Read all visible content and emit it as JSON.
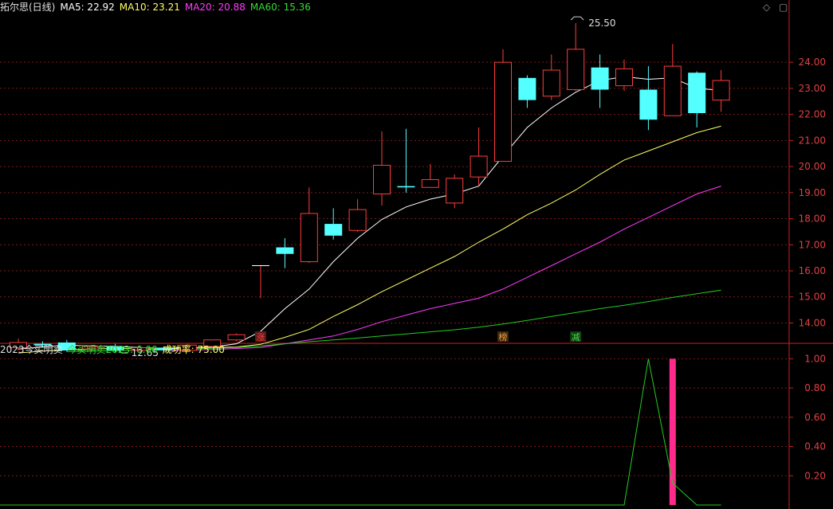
{
  "main_header": {
    "title": "拓尔思(日线)",
    "ma5": "MA5: 22.92",
    "ma10": "MA10: 23.21",
    "ma20": "MA20: 20.88",
    "ma60": "MA60: 15.36"
  },
  "sub_header": {
    "title": "2023今买明卖",
    "indicator": "今买明卖2023: 0.00",
    "success": "成功率: 75.00"
  },
  "corner_icons": [
    "diamond-icon",
    "restore-icon"
  ],
  "colors": {
    "up": "#ff3c3c",
    "down": "#54ffff",
    "ma5": "#ffffff",
    "ma10": "#ffff66",
    "ma20": "#ff3cff",
    "ma60": "#22cc22",
    "axis": "#cc2020",
    "signal_bar": "#ff2a8c"
  },
  "chart_data": [
    {
      "type": "candlestick",
      "title": "拓尔思(日线)",
      "ylim": [
        13.25,
        25.9
      ],
      "yticks": [
        14.0,
        15.0,
        16.0,
        17.0,
        18.0,
        19.0,
        20.0,
        21.0,
        22.0,
        23.0,
        24.0
      ],
      "ytick_labels": [
        "14.00",
        "15.00",
        "16.00",
        "17.00",
        "18.00",
        "19.00",
        "20.00",
        "21.00",
        "22.00",
        "23.00",
        "24.00"
      ],
      "candles": [
        {
          "o": 13.05,
          "h": 13.4,
          "l": 12.95,
          "c": 13.25
        },
        {
          "o": 13.2,
          "h": 13.3,
          "l": 13.05,
          "c": 13.15
        },
        {
          "o": 13.25,
          "h": 13.35,
          "l": 12.9,
          "c": 12.95
        },
        {
          "o": 13.0,
          "h": 13.15,
          "l": 12.9,
          "c": 13.1
        },
        {
          "o": 13.1,
          "h": 13.2,
          "l": 12.85,
          "c": 12.95
        },
        {
          "o": 12.95,
          "h": 13.15,
          "l": 12.9,
          "c": 13.05
        },
        {
          "o": 13.05,
          "h": 13.1,
          "l": 12.9,
          "c": 12.95
        },
        {
          "o": 12.95,
          "h": 13.2,
          "l": 12.9,
          "c": 13.15
        },
        {
          "o": 13.1,
          "h": 13.35,
          "l": 13.05,
          "c": 13.35
        },
        {
          "o": 13.35,
          "h": 13.6,
          "l": 13.3,
          "c": 13.55
        },
        {
          "o": 16.2,
          "h": 16.2,
          "l": 14.95,
          "c": 16.2
        },
        {
          "o": 16.9,
          "h": 17.25,
          "l": 16.1,
          "c": 16.65
        },
        {
          "o": 16.35,
          "h": 19.2,
          "l": 16.3,
          "c": 18.2
        },
        {
          "o": 17.8,
          "h": 18.4,
          "l": 17.2,
          "c": 17.35
        },
        {
          "o": 17.55,
          "h": 18.75,
          "l": 17.5,
          "c": 18.35
        },
        {
          "o": 18.95,
          "h": 21.35,
          "l": 18.5,
          "c": 20.05
        },
        {
          "o": 19.25,
          "h": 21.45,
          "l": 19.0,
          "c": 19.2
        },
        {
          "o": 19.2,
          "h": 20.1,
          "l": 19.2,
          "c": 19.5
        },
        {
          "o": 18.6,
          "h": 19.7,
          "l": 18.4,
          "c": 19.55
        },
        {
          "o": 19.6,
          "h": 21.5,
          "l": 19.3,
          "c": 20.4
        },
        {
          "o": 20.2,
          "h": 24.5,
          "l": 20.2,
          "c": 24.0
        },
        {
          "o": 23.4,
          "h": 23.5,
          "l": 22.25,
          "c": 22.55
        },
        {
          "o": 22.7,
          "h": 24.3,
          "l": 22.55,
          "c": 23.7
        },
        {
          "o": 22.95,
          "h": 25.5,
          "l": 22.9,
          "c": 24.5
        },
        {
          "o": 23.8,
          "h": 24.3,
          "l": 22.25,
          "c": 22.95
        },
        {
          "o": 23.1,
          "h": 24.1,
          "l": 22.9,
          "c": 23.75
        },
        {
          "o": 22.95,
          "h": 23.85,
          "l": 21.4,
          "c": 21.8
        },
        {
          "o": 21.95,
          "h": 24.7,
          "l": 21.95,
          "c": 23.85
        },
        {
          "o": 23.6,
          "h": 23.65,
          "l": 21.5,
          "c": 22.05
        },
        {
          "o": 22.55,
          "h": 23.7,
          "l": 22.1,
          "c": 23.3
        }
      ],
      "series": [
        {
          "name": "MA5",
          "values": [
            13.0,
            13.08,
            13.15,
            13.12,
            13.1,
            13.06,
            13.02,
            13.03,
            13.08,
            13.2,
            13.68,
            14.55,
            15.3,
            16.35,
            17.25,
            17.97,
            18.45,
            18.75,
            18.95,
            19.25,
            20.4,
            21.5,
            22.25,
            22.85,
            23.3,
            23.45,
            23.35,
            23.4,
            23.0,
            22.92
          ]
        },
        {
          "name": "MA10",
          "values": [
            12.85,
            12.92,
            12.97,
            13.0,
            13.02,
            13.03,
            13.04,
            13.05,
            13.06,
            13.08,
            13.18,
            13.45,
            13.75,
            14.25,
            14.7,
            15.2,
            15.65,
            16.1,
            16.55,
            17.1,
            17.6,
            18.15,
            18.6,
            19.1,
            19.7,
            20.25,
            20.6,
            20.95,
            21.3,
            21.55
          ]
        },
        {
          "name": "MA20",
          "values": [
            null,
            null,
            null,
            null,
            null,
            null,
            12.95,
            12.96,
            12.98,
            13.02,
            13.06,
            13.2,
            13.35,
            13.5,
            13.75,
            14.05,
            14.3,
            14.55,
            14.75,
            14.95,
            15.3,
            15.75,
            16.2,
            16.65,
            17.1,
            17.6,
            18.05,
            18.5,
            18.95,
            19.25
          ]
        },
        {
          "name": "MA60",
          "values": [
            null,
            null,
            12.9,
            12.92,
            12.94,
            12.96,
            12.98,
            13.0,
            13.03,
            13.06,
            13.12,
            13.2,
            13.28,
            13.35,
            13.42,
            13.5,
            13.58,
            13.66,
            13.74,
            13.84,
            13.96,
            14.1,
            14.25,
            14.4,
            14.55,
            14.68,
            14.82,
            14.98,
            15.12,
            15.26
          ]
        }
      ],
      "annotations": [
        {
          "text": "25.50",
          "index": 23,
          "value": 25.5
        },
        {
          "text": "12.65",
          "index": 4,
          "value": 12.85
        }
      ],
      "markers": [
        {
          "text": "涨",
          "index": 10,
          "color": "#ff3c3c",
          "bg": "#5a1a1a"
        },
        {
          "text": "榜",
          "index": 20,
          "color": "#ff9933",
          "bg": "#3a2a12"
        },
        {
          "text": "减",
          "index": 23,
          "color": "#44dd44",
          "bg": "#143a14"
        }
      ]
    },
    {
      "type": "line",
      "title": "2023今买明卖",
      "ylim": [
        0,
        1.1
      ],
      "yticks": [
        0.2,
        0.4,
        0.6,
        0.8,
        1.0
      ],
      "ytick_labels": [
        "0.20",
        "0.40",
        "0.60",
        "0.80",
        "1.00"
      ],
      "series": [
        {
          "name": "今买明卖2023",
          "values": [
            0,
            0,
            0,
            0,
            0,
            0,
            0,
            0,
            0,
            0,
            0,
            0,
            0,
            0,
            0,
            0,
            0,
            0,
            0,
            0,
            0,
            0,
            0,
            0,
            0,
            0,
            1,
            0.15,
            0,
            0
          ]
        }
      ],
      "bars": [
        {
          "index": 27,
          "value": 1.0
        }
      ],
      "ma_tail": [
        {
          "index": 25,
          "value": 0
        }
      ]
    }
  ]
}
